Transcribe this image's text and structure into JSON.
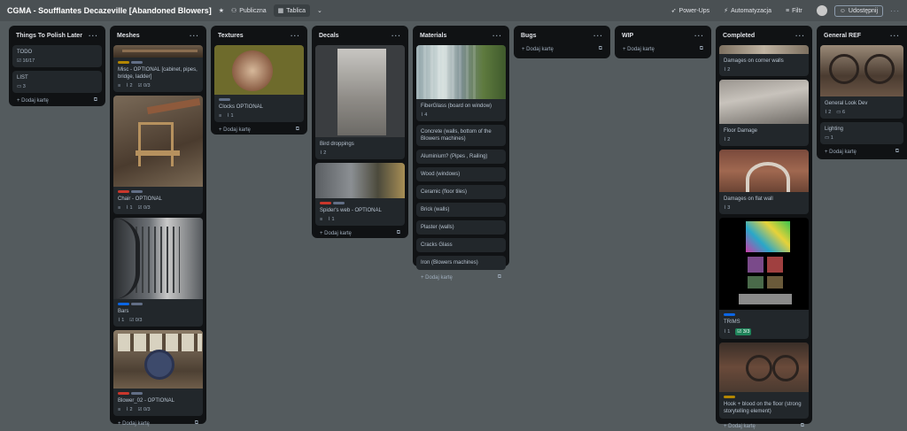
{
  "topbar": {
    "board_title": "CGMA - Soufflantes Decazeville [Abandoned Blowers]",
    "visibility": "Publiczna",
    "view": "Tablica",
    "powerups": "Power-Ups",
    "automation": "Automatyzacja",
    "filter": "Filtr",
    "share": "Udostępnij"
  },
  "add_card": "Dodaj kartę",
  "lists": {
    "polish": {
      "title": "Things To Polish Later",
      "cards": [
        {
          "title": "TODO",
          "checklist": "16/17"
        },
        {
          "title": "LIST",
          "comments": "3"
        }
      ]
    },
    "meshes": {
      "title": "Meshes",
      "cards": [
        {
          "title": "Misc - OPTIONAL [cabinet, pipes, bridge, ladder]",
          "attachments": "2",
          "checklist": "0/3"
        },
        {
          "title": "Chair - OPTIONAL",
          "attachments": "1",
          "checklist": "0/3"
        },
        {
          "title": "Bars",
          "attachments": "1",
          "checklist": "0/3"
        },
        {
          "title": "Blower_02 - OPTIONAL",
          "attachments": "2",
          "checklist": "0/3"
        }
      ]
    },
    "textures": {
      "title": "Textures",
      "cards": [
        {
          "title": "Clocks OPTIONAL",
          "attachments": "1"
        }
      ]
    },
    "decals": {
      "title": "Decals",
      "cards": [
        {
          "title": "Bird droppings",
          "attachments": "2"
        },
        {
          "title": "Spider's web - OPTIONAL",
          "attachments": "1"
        }
      ]
    },
    "materials": {
      "title": "Materials",
      "cards": [
        {
          "title": "FiberGlass (board on window)",
          "attachments": "4"
        },
        {
          "title": "Concrete (walls, bottom of the Blowers machines)"
        },
        {
          "title": "Aluminium? (Pipes , Railing)"
        },
        {
          "title": "Wood (windows)"
        },
        {
          "title": "Ceramic (floor tiles)"
        },
        {
          "title": "Brick (walls)"
        },
        {
          "title": "Plaster (walls)"
        },
        {
          "title": "Cracks Glass"
        },
        {
          "title": "Iron (Blowers machines)"
        }
      ]
    },
    "bugs": {
      "title": "Bugs"
    },
    "wip": {
      "title": "WIP"
    },
    "completed": {
      "title": "Completed",
      "cards": [
        {
          "title": "Damages on corner walls",
          "attachments": "2"
        },
        {
          "title": "Floor Damage",
          "attachments": "2"
        },
        {
          "title": "Damages on flat wall",
          "attachments": "3"
        },
        {
          "title": "TRIMS",
          "attachments": "1",
          "checklist": "3/3"
        },
        {
          "title": "Hook + blood on the floor (strong storytelling element)"
        }
      ]
    },
    "ref": {
      "title": "General REF",
      "cards": [
        {
          "title": "General Look Dev",
          "attachments": "2",
          "comments": "6"
        },
        {
          "title": "Lighting",
          "comments": "1"
        }
      ]
    }
  },
  "colors": {
    "board_bg": "#545b5e",
    "list_bg": "#101214",
    "card_bg": "#22272b",
    "label_yellow": "#b38600",
    "label_red": "#c9372c",
    "label_blue": "#0c66e4",
    "label_gray": "#626f86",
    "label_green": "#1f845a"
  }
}
